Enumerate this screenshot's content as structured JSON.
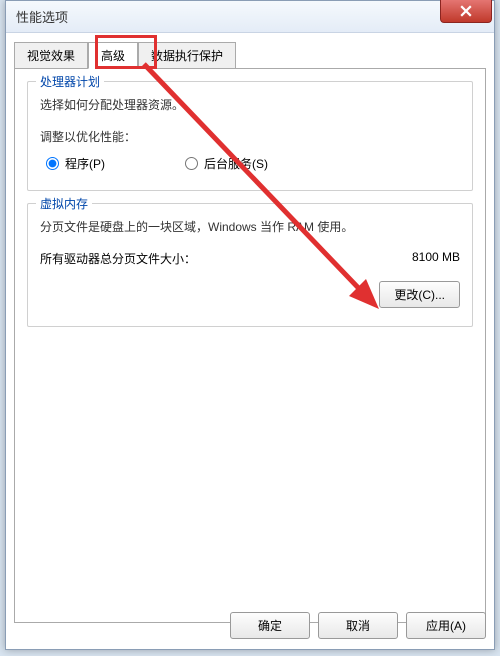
{
  "window": {
    "title": "性能选项"
  },
  "tabs": {
    "visual": "视觉效果",
    "advanced": "高级",
    "dep": "数据执行保护"
  },
  "processor": {
    "legend": "处理器计划",
    "desc": "选择如何分配处理器资源。",
    "optimize_label": "调整以优化性能：",
    "program": "程序(P)",
    "background": "后台服务(S)"
  },
  "vm": {
    "legend": "虚拟内存",
    "desc": "分页文件是硬盘上的一块区域，Windows 当作 RAM 使用。",
    "total_label": "所有驱动器总分页文件大小：",
    "total_value": "8100 MB",
    "change": "更改(C)..."
  },
  "buttons": {
    "ok": "确定",
    "cancel": "取消",
    "apply": "应用(A)"
  }
}
